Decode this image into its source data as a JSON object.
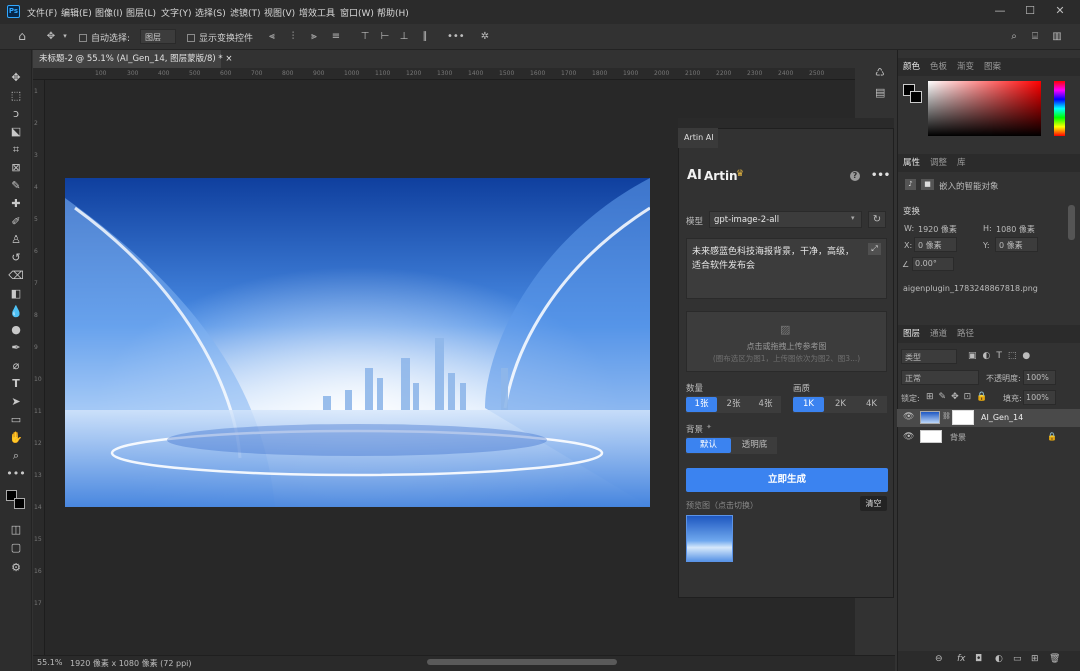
{
  "app": {
    "logo": "Ps",
    "menus": [
      "文件(F)",
      "编辑(E)",
      "图像(I)",
      "图层(L)",
      "文字(Y)",
      "选择(S)",
      "滤镜(T)",
      "视图(V)",
      "增效工具",
      "窗口(W)",
      "帮助(H)"
    ],
    "window_controls": [
      "—",
      "☐",
      "✕"
    ]
  },
  "options": {
    "auto_select_label": "自动选择:",
    "auto_select_value": "图层",
    "show_transform_label": "显示变换控件",
    "more": "•••"
  },
  "document": {
    "tab_title": "未标题-2 @ 55.1% (AI_Gen_14, 图层蒙版/8) *",
    "close": "×"
  },
  "ruler": {
    "h_ticks": [
      "100",
      "300",
      "400",
      "500",
      "600",
      "700",
      "800",
      "900",
      "1000",
      "1100",
      "1200",
      "1300",
      "1400",
      "1500",
      "1600",
      "1700",
      "1800",
      "1900",
      "2000",
      "2100",
      "2200",
      "2300",
      "2400",
      "2500"
    ],
    "v_ticks": [
      "1",
      "2",
      "3",
      "4",
      "5",
      "6",
      "7",
      "8",
      "9",
      "10",
      "11",
      "12",
      "13",
      "14",
      "15",
      "16",
      "17"
    ]
  },
  "status": {
    "zoom": "55.1%",
    "doc_info": "1920 像素 x 1080 像素 (72 ppi)"
  },
  "plugin": {
    "tab": "Artin AI",
    "brand": "Artin",
    "help": "?",
    "more": "•••",
    "model_label": "模型",
    "model_value": "gpt-image-2-all",
    "prompt": "未来感蓝色科技海报背景，干净，高级，适合软件发布会",
    "upload_text": "点击或拖拽上传参考图",
    "upload_hint": "(圈布选区为图1，上传图依次为图2、图3...)",
    "count_label": "数量",
    "count_options": [
      "1张",
      "2张",
      "4张"
    ],
    "quality_label": "画质",
    "quality_options": [
      "1K",
      "2K",
      "4K"
    ],
    "bg_label": "背景",
    "bg_options": [
      "默认",
      "透明底"
    ],
    "generate": "立即生成",
    "preview_label": "预览图（点击切换）",
    "clear": "清空"
  },
  "color_panel": {
    "tabs": [
      "颜色",
      "色板",
      "渐变",
      "图案"
    ]
  },
  "props_panel": {
    "tabs": [
      "属性",
      "调整",
      "库"
    ],
    "object_label": "嵌入的智能对象",
    "transform_title": "变换",
    "w_label": "W:",
    "w_value": "1920 像素",
    "h_label": "H:",
    "h_value": "1080 像素",
    "x_label": "X:",
    "x_value": "0 像素",
    "y_label": "Y:",
    "y_value": "0 像素",
    "angle_value": "0.00°",
    "filename": "aigenplugin_1783248867818.png"
  },
  "layers_panel": {
    "tabs": [
      "图层",
      "通道",
      "路径"
    ],
    "filter_label": "类型",
    "blend_mode": "正常",
    "opacity_label": "不透明度:",
    "opacity_value": "100%",
    "lock_label": "锁定:",
    "fill_label": "填充:",
    "fill_value": "100%",
    "layers": [
      {
        "name": "AI_Gen_14"
      },
      {
        "name": "背景"
      }
    ],
    "footer_icons": [
      "⊖",
      "fx",
      "◘",
      "◐",
      "▭",
      "⊞",
      "🗑"
    ]
  },
  "colors": {
    "accent": "#3b83f0",
    "panel": "#323232",
    "menubar": "#2b2b2b",
    "canvas_bg": "#282828"
  }
}
